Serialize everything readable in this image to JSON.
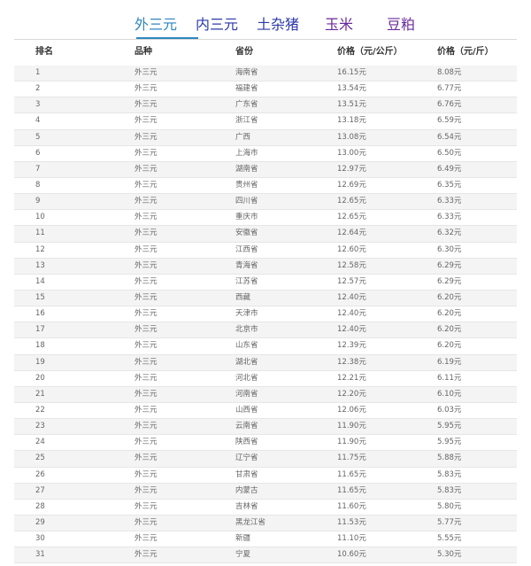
{
  "tabs": [
    {
      "label": "外三元",
      "color": "#2e86c1"
    },
    {
      "label": "内三元",
      "color": "#2a39a8"
    },
    {
      "label": "土杂猪",
      "color": "#2a39a8"
    },
    {
      "label": "玉米",
      "color": "#6a2a99"
    },
    {
      "label": "豆粕",
      "color": "#6a2a99"
    }
  ],
  "active_tab": 0,
  "table": {
    "headers": [
      "排名",
      "品种",
      "省份",
      "价格（元/公斤）",
      "价格（元/斤）"
    ],
    "rows": [
      [
        "1",
        "外三元",
        "海南省",
        "16.15元",
        "8.08元"
      ],
      [
        "2",
        "外三元",
        "福建省",
        "13.54元",
        "6.77元"
      ],
      [
        "3",
        "外三元",
        "广东省",
        "13.51元",
        "6.76元"
      ],
      [
        "4",
        "外三元",
        "浙江省",
        "13.18元",
        "6.59元"
      ],
      [
        "5",
        "外三元",
        "广西",
        "13.08元",
        "6.54元"
      ],
      [
        "6",
        "外三元",
        "上海市",
        "13.00元",
        "6.50元"
      ],
      [
        "7",
        "外三元",
        "湖南省",
        "12.97元",
        "6.49元"
      ],
      [
        "8",
        "外三元",
        "贵州省",
        "12.69元",
        "6.35元"
      ],
      [
        "9",
        "外三元",
        "四川省",
        "12.65元",
        "6.33元"
      ],
      [
        "10",
        "外三元",
        "重庆市",
        "12.65元",
        "6.33元"
      ],
      [
        "11",
        "外三元",
        "安徽省",
        "12.64元",
        "6.32元"
      ],
      [
        "12",
        "外三元",
        "江西省",
        "12.60元",
        "6.30元"
      ],
      [
        "13",
        "外三元",
        "青海省",
        "12.58元",
        "6.29元"
      ],
      [
        "14",
        "外三元",
        "江苏省",
        "12.57元",
        "6.29元"
      ],
      [
        "15",
        "外三元",
        "西藏",
        "12.40元",
        "6.20元"
      ],
      [
        "16",
        "外三元",
        "天津市",
        "12.40元",
        "6.20元"
      ],
      [
        "17",
        "外三元",
        "北京市",
        "12.40元",
        "6.20元"
      ],
      [
        "18",
        "外三元",
        "山东省",
        "12.39元",
        "6.20元"
      ],
      [
        "19",
        "外三元",
        "湖北省",
        "12.38元",
        "6.19元"
      ],
      [
        "20",
        "外三元",
        "河北省",
        "12.21元",
        "6.11元"
      ],
      [
        "21",
        "外三元",
        "河南省",
        "12.20元",
        "6.10元"
      ],
      [
        "22",
        "外三元",
        "山西省",
        "12.06元",
        "6.03元"
      ],
      [
        "23",
        "外三元",
        "云南省",
        "11.90元",
        "5.95元"
      ],
      [
        "24",
        "外三元",
        "陕西省",
        "11.90元",
        "5.95元"
      ],
      [
        "25",
        "外三元",
        "辽宁省",
        "11.75元",
        "5.88元"
      ],
      [
        "26",
        "外三元",
        "甘肃省",
        "11.65元",
        "5.83元"
      ],
      [
        "27",
        "外三元",
        "内蒙古",
        "11.65元",
        "5.83元"
      ],
      [
        "28",
        "外三元",
        "吉林省",
        "11.60元",
        "5.80元"
      ],
      [
        "29",
        "外三元",
        "黑龙江省",
        "11.53元",
        "5.77元"
      ],
      [
        "30",
        "外三元",
        "新疆",
        "11.10元",
        "5.55元"
      ],
      [
        "31",
        "外三元",
        "宁夏",
        "10.60元",
        "5.30元"
      ]
    ]
  }
}
